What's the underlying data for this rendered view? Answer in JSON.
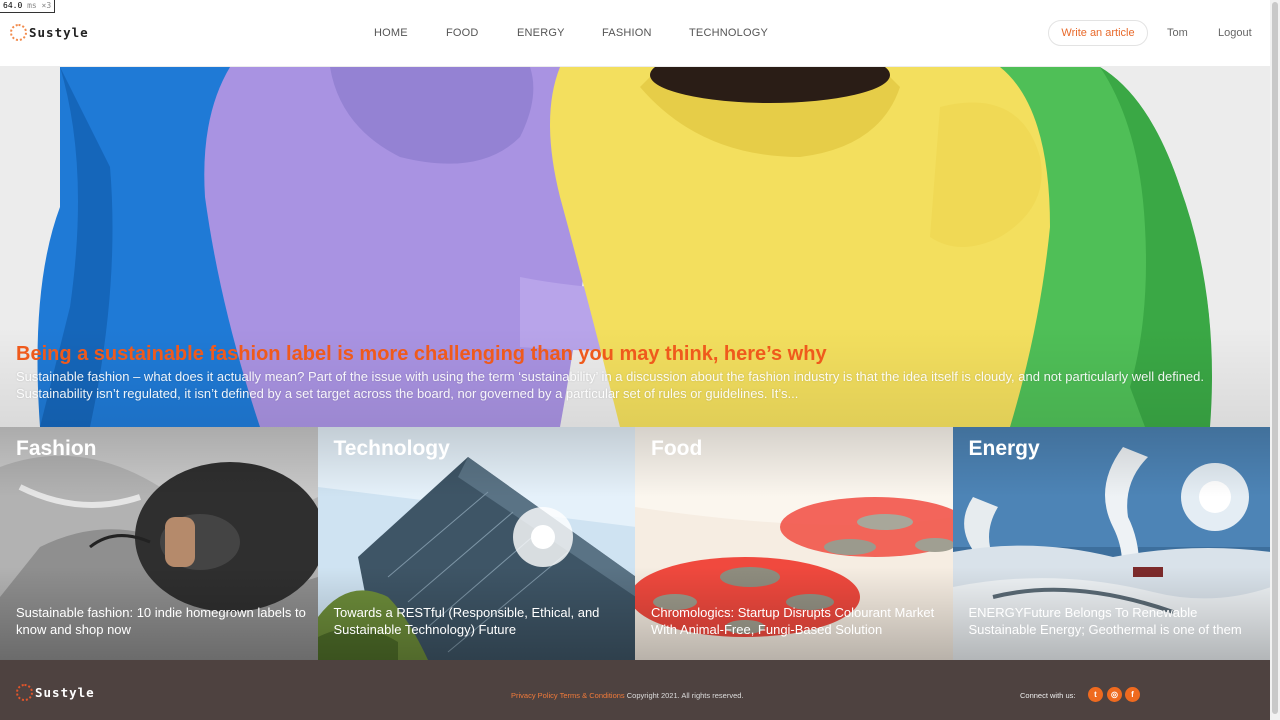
{
  "perf_badge": {
    "value": "64.0",
    "unit": "ms ×3"
  },
  "brand": {
    "name": "Sustyle"
  },
  "nav": {
    "items": [
      {
        "label": "HOME"
      },
      {
        "label": "FOOD"
      },
      {
        "label": "ENERGY"
      },
      {
        "label": "FASHION"
      },
      {
        "label": "TECHNOLOGY"
      }
    ],
    "write_label": "Write an article",
    "user_name": "Tom",
    "logout_label": "Logout"
  },
  "hero": {
    "title": "Being a sustainable fashion label is more challenging than you may think, here’s why",
    "excerpt": "Sustainable fashion – what does it actually mean? Part of the issue with using the term ‘sustainability’ in a discussion about the fashion industry is that the idea itself is cloudy, and not particularly well defined. Sustainability isn’t regulated, it isn’t defined by a set target across the board, nor governed by a particular set of rules or guidelines. It’s..."
  },
  "categories": [
    {
      "title": "Fashion",
      "article": "Sustainable fashion: 10 indie homegrown labels to know and shop now"
    },
    {
      "title": "Technology",
      "article": "Towards a RESTful (Responsible, Ethical, and Sustainable Technology) Future"
    },
    {
      "title": "Food",
      "article": "Chromologics: Startup Disrupts Colourant Market With Animal-Free, Fungi-Based Solution"
    },
    {
      "title": "Energy",
      "article": "ENERGYFuture Belongs To Renewable Sustainable Energy; Geothermal is one of them"
    }
  ],
  "footer": {
    "privacy": "Privacy Policy",
    "terms": "Terms & Conditions",
    "copyright": "Copyright 2021. All rights reserved.",
    "connect": "Connect with us:",
    "social": [
      {
        "icon": "twitter-icon",
        "glyph": "t"
      },
      {
        "icon": "instagram-icon",
        "glyph": "◎"
      },
      {
        "icon": "facebook-icon",
        "glyph": "f"
      }
    ]
  },
  "colors": {
    "accent": "#ef5a1c",
    "footer_bg": "#4e4240"
  }
}
